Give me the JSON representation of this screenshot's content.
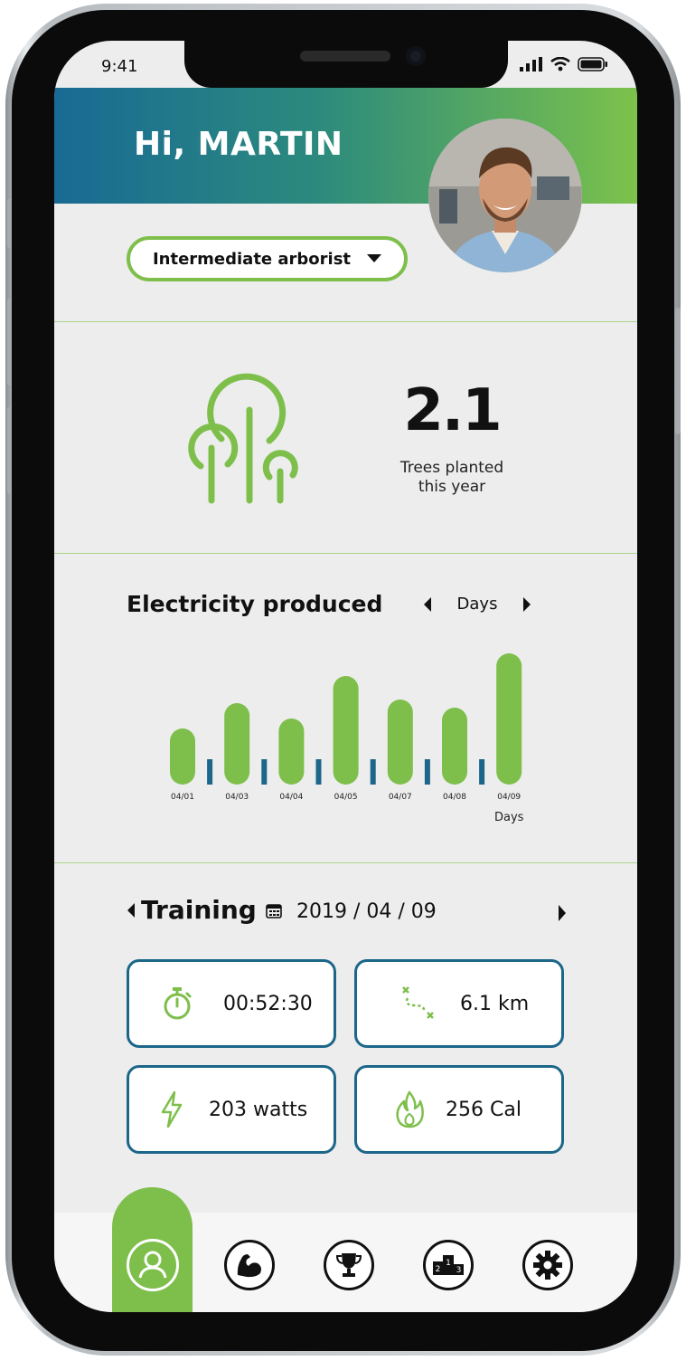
{
  "status_bar": {
    "time": "9:41"
  },
  "header": {
    "greeting": "Hi, MARTIN"
  },
  "level_selector": {
    "value": "Intermediate arborist"
  },
  "trees": {
    "value": "2.1",
    "label_line1": "Trees planted",
    "label_line2": "this year"
  },
  "electricity": {
    "title": "Electricity produced",
    "period": "Days"
  },
  "chart_data": {
    "type": "bar",
    "categories": [
      "04/01",
      "04/03",
      "04/04",
      "04/05",
      "04/07",
      "04/08",
      "04/09"
    ],
    "series": [
      {
        "values": [
          62,
          90,
          73,
          120,
          94,
          85,
          145
        ],
        "color": "#7ebf4b"
      },
      {
        "values": [
          28,
          28,
          28,
          28,
          28,
          28
        ],
        "color": "#1c6689"
      }
    ],
    "xlabel": "Days",
    "ylabel": "",
    "grid": false
  },
  "training": {
    "title": "Training",
    "date": "2019 / 04 / 09",
    "stats": [
      {
        "icon": "stopwatch-icon",
        "value": "00:52:30"
      },
      {
        "icon": "route-icon",
        "value": "6.1 km"
      },
      {
        "icon": "lightning-icon",
        "value": "203 watts"
      },
      {
        "icon": "flame-icon",
        "value": "256 Cal"
      }
    ]
  },
  "colors": {
    "green": "#7ebf4b",
    "blue": "#1c6689",
    "header_start": "#196a94"
  },
  "nav": [
    "profile-icon",
    "muscle-icon",
    "trophy-icon",
    "podium-icon",
    "gear-icon"
  ]
}
